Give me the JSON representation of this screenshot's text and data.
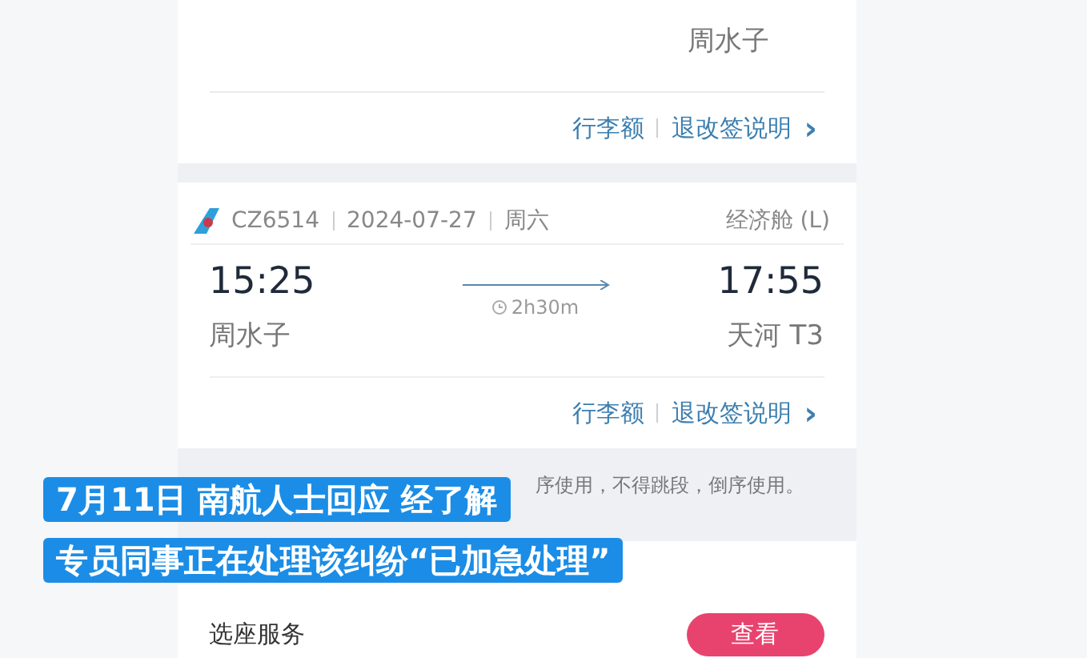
{
  "flights": [
    {
      "arrival_city": "周水子",
      "links": [
        "行李额",
        "退改签说明"
      ],
      "chevron": "›"
    },
    {
      "flight_no": "CZ6514",
      "date": "2024-07-27",
      "weekday": "周六",
      "cabin": "经济舱 (L)",
      "dep_time": "15:25",
      "dep_city": "周水子",
      "duration": "2h30m",
      "arr_time": "17:55",
      "arr_city": "天河 T3",
      "links": [
        "行李额",
        "退改签说明"
      ],
      "chevron": "›"
    }
  ],
  "notice": "序使用，不得跳段，倒序使用。",
  "seat_service": {
    "label": "选座服务",
    "button": "查看"
  },
  "captions": [
    "7月11日 南航人士回应 经了解",
    "专员同事正在处理该纠纷“已加急处理”"
  ]
}
